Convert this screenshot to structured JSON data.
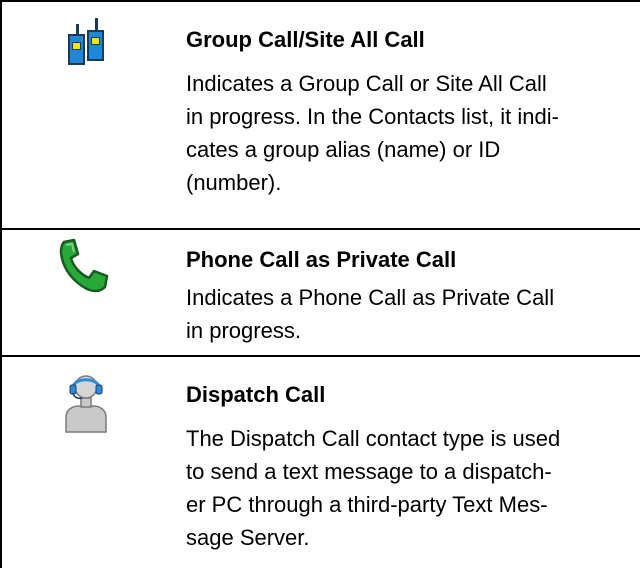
{
  "rows": [
    {
      "icon": "group-call-walkie-talkies-icon",
      "title": "Group Call/Site All Call",
      "lines": [
        "Indicates a Group Call or Site All Call",
        "in progress. In the Contacts list, it indi-",
        "cates a group alias (name) or ID",
        "(number)."
      ]
    },
    {
      "icon": "phone-handset-icon",
      "title": "Phone Call as Private Call",
      "lines": [
        "Indicates a Phone Call as Private Call",
        "in progress."
      ]
    },
    {
      "icon": "dispatcher-headset-icon",
      "title": "Dispatch Call",
      "lines": [
        "The Dispatch Call contact type is used",
        "to send a text message to a dispatch-",
        "er PC through a third-party Text Mes-",
        "sage Server."
      ]
    }
  ],
  "colors": {
    "radio_blue": "#1e88d8",
    "radio_dark": "#1a3a5c",
    "radio_yellow": "#f2e600",
    "phone_green": "#27a839",
    "phone_dark": "#155c1e",
    "person_gray": "#c9c9c9",
    "headset_blue": "#2c8ad8"
  }
}
